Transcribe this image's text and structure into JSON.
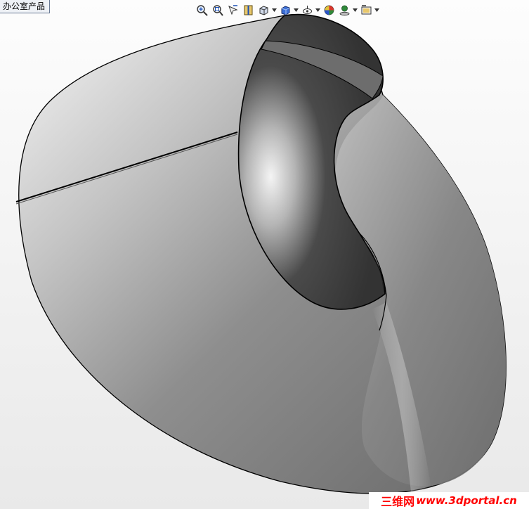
{
  "document_tab": {
    "label": "办公室产品"
  },
  "toolbar": {
    "buttons": [
      {
        "name": "zoom-to-fit-icon"
      },
      {
        "name": "zoom-to-area-icon"
      },
      {
        "name": "previous-view-icon"
      },
      {
        "name": "section-view-icon"
      },
      {
        "name": "view-orientation-icon",
        "dropdown": true
      },
      {
        "name": "display-style-icon",
        "dropdown": true
      },
      {
        "name": "hide-show-items-icon",
        "dropdown": true
      },
      {
        "name": "edit-appearance-icon"
      },
      {
        "name": "apply-scene-icon",
        "dropdown": true
      },
      {
        "name": "view-settings-icon",
        "dropdown": true
      }
    ]
  },
  "model": {
    "shading_color": "#7a7a7a",
    "edge_color": "#000000"
  },
  "watermark": {
    "text_cn": "三维网",
    "text_url": "www.3dportal.cn",
    "color": "#ff0000"
  }
}
